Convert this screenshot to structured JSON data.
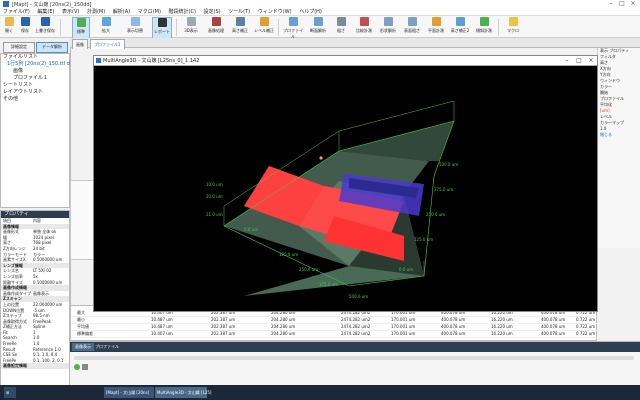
{
  "app": {
    "title": "[Mapt] - 文山嬢 [20ns(2)_150dd]",
    "menu": [
      "ファイル(F)",
      "編集(E)",
      "表示(V)",
      "計測(M)",
      "解析(A)",
      "マクロ(M)",
      "階段統計(C)",
      "設定(S)",
      "ツール(T)",
      "ウィンドウ(W)",
      "ヘルプ(H)"
    ]
  },
  "ribbon": {
    "buttons": [
      "開く",
      "保存",
      "上書き保存",
      "標準",
      "拡大",
      "表示切替",
      "レポート",
      "3D表示",
      "画像処理",
      "高さ補正",
      "レベル補正",
      "プロファイル",
      "断面解析",
      "粗さ",
      "比較計測",
      "形状解析",
      "表面粗さ",
      "平面計測",
      "高さ補正2",
      "傾斜計測",
      "マクロ"
    ]
  },
  "left": {
    "buttons": [
      "詳細設定",
      "データ解析"
    ],
    "tree": [
      "ファイルリスト",
      "1行5列 [20ns(2)_150.ttl dd]",
      "画像",
      "プロファイル１",
      "シートリスト",
      "レイアウトリスト",
      "その他"
    ]
  },
  "props": {
    "header": "プロパティ",
    "rows": [
      [
        "項目",
        "内容"
      ],
      [
        "画像情報",
        ""
      ],
      [
        "画像形式",
        "単独 全体 ok"
      ],
      [
        "幅",
        "1024 pixel"
      ],
      [
        "高さ",
        "768 pixel"
      ],
      [
        "Z方向レンジ",
        "24 bit"
      ],
      [
        "カラーモード",
        "カラー"
      ],
      [
        "画素サイズX",
        "0.5000000 um"
      ],
      [
        "レンズ情報",
        ""
      ],
      [
        "レンズ名",
        "LT 5X/ 02"
      ],
      [
        "レンズ倍率",
        "5x"
      ],
      [
        "距離サイズ",
        "0.5000000 um"
      ],
      [
        "画像作成情報",
        ""
      ],
      [
        "画像作成タイプ",
        "画像表示"
      ],
      [
        "Zスキャン",
        ""
      ],
      [
        "上の位置",
        "22.000000 um"
      ],
      [
        "DOWN位置",
        "-5 um"
      ],
      [
        "Zステップ",
        "98.5 nm"
      ],
      [
        "画像取得方式",
        "FreePeak"
      ],
      [
        "Z補正方法",
        "Spline"
      ],
      [
        "  Fit",
        "1"
      ],
      [
        "  Search",
        "1.0"
      ],
      [
        "  FreeRe",
        "1.0"
      ],
      [
        "  Result",
        "Reference 1.0"
      ],
      [
        "  CSE Se",
        "0.1, 1.0, 0.4"
      ],
      [
        "  FreePe",
        "0.1, 100, 2, 0.1"
      ],
      [
        "画像設定情報",
        ""
      ]
    ]
  },
  "workspace": {
    "tabs": [
      "画像",
      "プロファイル1"
    ]
  },
  "window3d": {
    "title": "MultiAngle3D - 文山嬢 [L25ns_0]_1.142",
    "axis_labels": [
      "0.0 um",
      "125.0 um",
      "250.0 um",
      "375.0 um",
      "500.0 um",
      "0.0 um",
      "125.0 um",
      "250.0 um",
      "375.0 um",
      "500.0 um",
      "21.0 um",
      "20.0 um",
      "10.0 um"
    ]
  },
  "table": {
    "rows": [
      [
        "最大",
        "10.407 um",
        "202.387 um",
        "204.280 um",
        "2474.282 um2",
        "170.001 um",
        "400.078 um",
        "16.220 um",
        "400.078 um",
        "0.722 um"
      ],
      [
        "最小",
        "10.487 um",
        "202.387 um",
        "204.280 um",
        "2474.282 um2",
        "170.001 um",
        "400.078 um",
        "16.220 um",
        "400.078 um",
        "0.722 um"
      ],
      [
        "平均値",
        "10.487 um",
        "202.387 um",
        "204.280 um",
        "2474.282 um2",
        "170.001 um",
        "400.078 um",
        "16.220 um",
        "400.078 um",
        "0.722 um"
      ],
      [
        "標準偏差",
        "10.407 um",
        "202.387 um",
        "204.280 um",
        "2474.282 um2",
        "170.001 um",
        "400.078 um",
        "16.220 um",
        "400.078 um",
        "0.722 um"
      ]
    ]
  },
  "bottom": {
    "tabs": [
      "画像表示",
      "プロファイル"
    ]
  },
  "right": {
    "labels": [
      "表示 プロパティ",
      "フィルタ",
      "高さ",
      "X方向",
      "Y方向",
      "ウィンドウ",
      "カラー",
      "開始",
      "プロファイル",
      "平均化",
      "[um]",
      "レベル",
      "カラーマップ",
      "1.0",
      "閉じる"
    ]
  },
  "taskbar": {
    "items": [
      "[Mapt] - 文山嬢 [20ns]",
      "MultiAngle3D - 文山嬢 [L25]"
    ]
  }
}
